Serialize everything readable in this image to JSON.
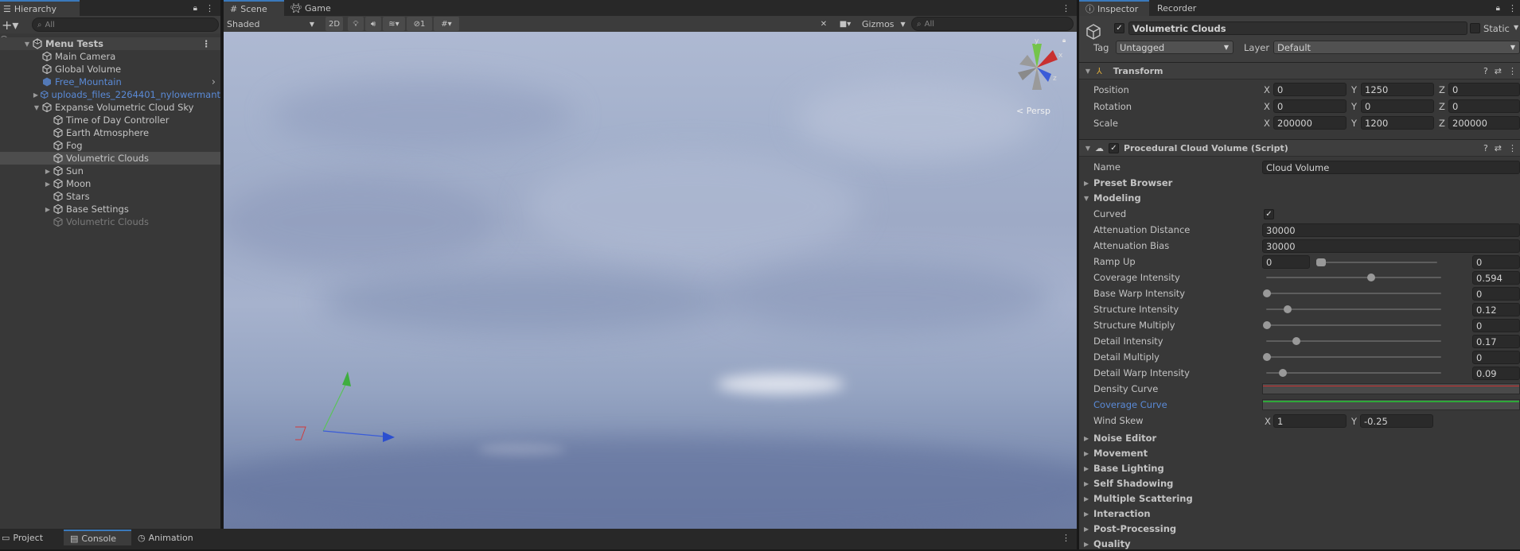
{
  "hierarchy": {
    "tab_label": "Hierarchy",
    "search_placeholder": "All",
    "scene_name": "Menu Tests",
    "items": [
      {
        "label": "Main Camera",
        "depth": 1,
        "expander": "",
        "color": "#c4c4c4"
      },
      {
        "label": "Global Volume",
        "depth": 1,
        "expander": "",
        "color": "#c4c4c4"
      },
      {
        "label": "Free_Mountain",
        "depth": 1,
        "expander": "",
        "color": "#5a8ad6"
      },
      {
        "label": "uploads_files_2264401_nylowermant",
        "depth": 1,
        "expander": "▶",
        "color": "#5a8ad6"
      },
      {
        "label": "Expanse Volumetric Cloud Sky",
        "depth": 1,
        "expander": "▼",
        "color": "#c4c4c4"
      },
      {
        "label": "Time of Day Controller",
        "depth": 2,
        "expander": "",
        "color": "#c4c4c4"
      },
      {
        "label": "Earth Atmosphere",
        "depth": 2,
        "expander": "",
        "color": "#c4c4c4"
      },
      {
        "label": "Fog",
        "depth": 2,
        "expander": "",
        "color": "#c4c4c4"
      },
      {
        "label": "Volumetric Clouds",
        "depth": 2,
        "expander": "",
        "color": "#c4c4c4",
        "selected": true
      },
      {
        "label": "Sun",
        "depth": 2,
        "expander": "▶",
        "color": "#c4c4c4"
      },
      {
        "label": "Moon",
        "depth": 2,
        "expander": "▶",
        "color": "#c4c4c4"
      },
      {
        "label": "Stars",
        "depth": 2,
        "expander": "",
        "color": "#c4c4c4"
      },
      {
        "label": "Base Settings",
        "depth": 2,
        "expander": "▶",
        "color": "#c4c4c4"
      },
      {
        "label": "Volumetric Clouds",
        "depth": 2,
        "expander": "",
        "color": "#7a7a7a",
        "disabled": true
      }
    ]
  },
  "scene_view": {
    "tabs": [
      {
        "label": "Scene",
        "icon": "scene-icon"
      },
      {
        "label": "Game",
        "icon": "game-icon"
      }
    ],
    "shading_mode": "Shaded",
    "mode_2d_label": "2D",
    "hidden_count": "1",
    "gizmos_label": "Gizmos",
    "search_placeholder": "All",
    "persp_label": "< Persp",
    "axis_labels": {
      "x": "x",
      "y": "y",
      "z": "z"
    }
  },
  "bottom_tabs": [
    {
      "label": "Project",
      "icon": "folder-icon"
    },
    {
      "label": "Console",
      "icon": "console-icon"
    },
    {
      "label": "Animation",
      "icon": "animation-icon"
    }
  ],
  "inspector": {
    "tabs": [
      "Inspector",
      "Recorder"
    ],
    "object_name": "Volumetric Clouds",
    "static_label": "Static",
    "tag_label": "Tag",
    "tag_value": "Untagged",
    "layer_label": "Layer",
    "layer_value": "Default",
    "transform": {
      "title": "Transform",
      "position": {
        "label": "Position",
        "x": "0",
        "y": "1250",
        "z": "0"
      },
      "rotation": {
        "label": "Rotation",
        "x": "0",
        "y": "0",
        "z": "0"
      },
      "scale": {
        "label": "Scale",
        "x": "200000",
        "y": "1200",
        "z": "200000"
      }
    },
    "script": {
      "title": "Procedural Cloud Volume (Script)",
      "name_label": "Name",
      "name_value": "Cloud Volume",
      "preset_browser": "Preset Browser",
      "modeling": "Modeling",
      "curved_label": "Curved",
      "attenuation_distance": {
        "label": "Attenuation Distance",
        "value": "30000"
      },
      "attenuation_bias": {
        "label": "Attenuation Bias",
        "value": "30000"
      },
      "ramp_up": {
        "label": "Ramp Up",
        "min": "0",
        "max": "0"
      },
      "sliders": [
        {
          "label": "Coverage Intensity",
          "value": "0.594",
          "fraction": 0.594
        },
        {
          "label": "Base Warp Intensity",
          "value": "0",
          "fraction": 0
        },
        {
          "label": "Structure Intensity",
          "value": "0.12",
          "fraction": 0.12
        },
        {
          "label": "Structure Multiply",
          "value": "0",
          "fraction": 0
        },
        {
          "label": "Detail Intensity",
          "value": "0.17",
          "fraction": 0.17
        },
        {
          "label": "Detail Multiply",
          "value": "0",
          "fraction": 0
        },
        {
          "label": "Detail Warp Intensity",
          "value": "0.09",
          "fraction": 0.09
        }
      ],
      "density_curve": "Density Curve",
      "coverage_curve": "Coverage Curve",
      "wind_skew": {
        "label": "Wind Skew",
        "x": "1",
        "y": "-0.25"
      },
      "sections": [
        "Noise Editor",
        "Movement",
        "Base Lighting",
        "Self Shadowing",
        "Multiple Scattering",
        "Interaction",
        "Post-Processing",
        "Quality"
      ]
    },
    "axis": {
      "x": "X",
      "y": "Y",
      "z": "Z"
    }
  },
  "colors": {
    "accent": "#3a79bb",
    "density_curve": "#c83232",
    "coverage_curve": "#2fa83a",
    "link": "#5a8ad6"
  }
}
